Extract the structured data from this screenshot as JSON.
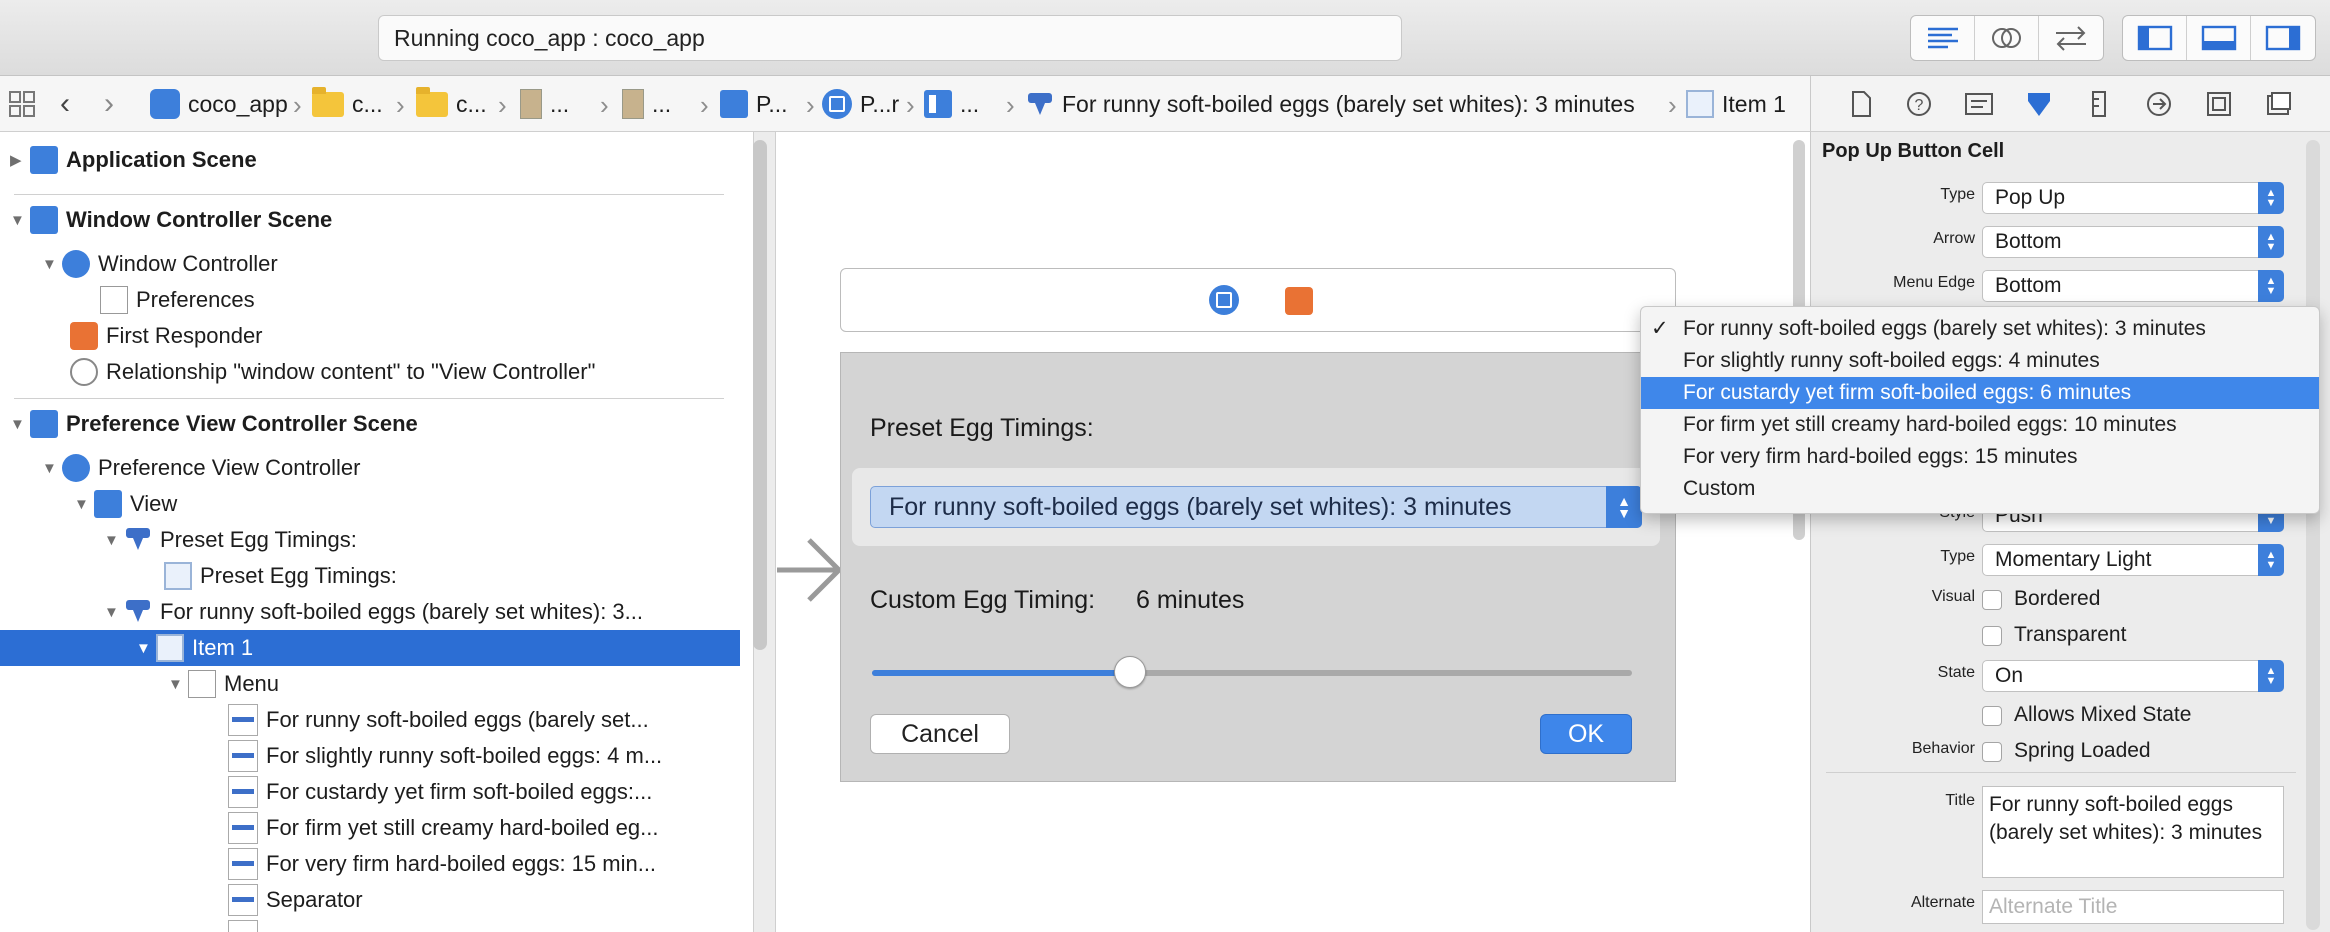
{
  "toolbar": {
    "status": "Running coco_app : coco_app"
  },
  "jumpbar": {
    "crumbs": [
      "coco_app",
      "c...",
      "c...",
      "...",
      "...",
      "P...",
      "P...r",
      "...",
      "For runny soft-boiled eggs (barely set whites): 3 minutes",
      "Item 1"
    ]
  },
  "outline": {
    "rows": [
      {
        "label": "Application Scene"
      },
      {
        "label": "Window Controller Scene"
      },
      {
        "label": "Window Controller"
      },
      {
        "label": "Preferences"
      },
      {
        "label": "First Responder"
      },
      {
        "label": "Relationship \"window content\" to \"View Controller\""
      },
      {
        "label": "Preference View Controller Scene"
      },
      {
        "label": "Preference View Controller"
      },
      {
        "label": "View"
      },
      {
        "label": "Preset Egg Timings:"
      },
      {
        "label": "Preset Egg Timings:"
      },
      {
        "label": "For runny soft-boiled eggs (barely set whites): 3..."
      },
      {
        "label": "Item 1"
      },
      {
        "label": "Menu"
      },
      {
        "label": "For runny soft-boiled eggs (barely set..."
      },
      {
        "label": "For slightly runny soft-boiled eggs: 4 m..."
      },
      {
        "label": "For custardy yet firm soft-boiled eggs:..."
      },
      {
        "label": "For firm yet still creamy hard-boiled eg..."
      },
      {
        "label": "For very firm hard-boiled eggs: 15 min..."
      },
      {
        "label": "Separator"
      }
    ]
  },
  "canvas": {
    "preset_label": "Preset Egg Timings:",
    "popup_value": "For runny soft-boiled eggs (barely set whites): 3 minutes",
    "custom_label": "Custom Egg Timing:",
    "custom_value": "6 minutes",
    "slider_fraction": 0.34,
    "cancel": "Cancel",
    "ok": "OK"
  },
  "inspector": {
    "section_title": "Pop Up Button Cell",
    "type_label": "Type",
    "type_value": "Pop Up",
    "arrow_label": "Arrow",
    "arrow_value": "Bottom",
    "menuedge_label": "Menu Edge",
    "menuedge_value": "Bottom",
    "style_label": "Style",
    "style_value": "Push",
    "type2_label": "Type",
    "type2_value": "Momentary Light",
    "visual_label": "Visual",
    "bordered": "Bordered",
    "transparent": "Transparent",
    "state_label": "State",
    "state_value": "On",
    "allows_mixed": "Allows Mixed State",
    "behavior_label": "Behavior",
    "spring_loaded": "Spring Loaded",
    "title_label": "Title",
    "title_value": "For runny soft-boiled eggs (barely set whites): 3 minutes",
    "alternate_label": "Alternate",
    "alternate_placeholder": "Alternate Title"
  },
  "menu": {
    "items": [
      "For runny soft-boiled eggs (barely set whites): 3 minutes",
      "For slightly runny soft-boiled eggs: 4 minutes",
      "For custardy yet firm soft-boiled eggs: 6 minutes",
      "For firm yet still creamy hard-boiled eggs: 10 minutes",
      "For very firm hard-boiled eggs: 15 minutes",
      "Custom"
    ],
    "checked_index": 0,
    "highlighted_index": 2
  },
  "colors": {
    "accent": "#3d7fdb",
    "selection": "#2c6ed4"
  }
}
